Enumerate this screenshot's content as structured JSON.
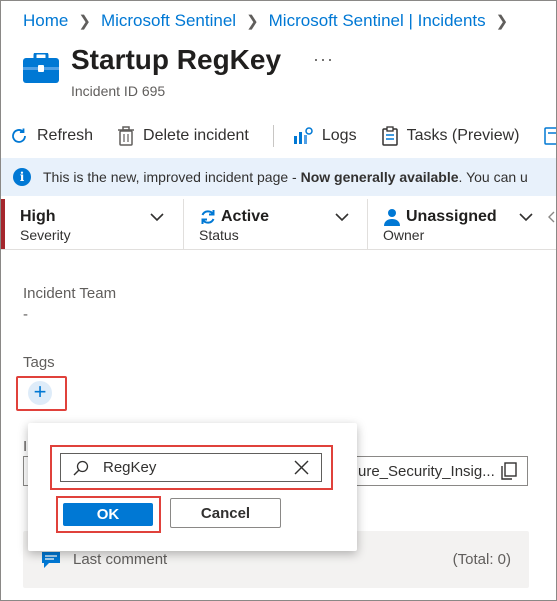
{
  "breadcrumb": [
    {
      "label": "Home"
    },
    {
      "label": "Microsoft Sentinel"
    },
    {
      "label": "Microsoft Sentinel | Incidents"
    }
  ],
  "header": {
    "title": "Startup RegKey",
    "more_label": "···",
    "subtitle": "Incident ID 695"
  },
  "toolbar": {
    "refresh": "Refresh",
    "delete": "Delete incident",
    "logs": "Logs",
    "tasks": "Tasks (Preview)"
  },
  "banner": {
    "text_before": "This is the new, improved incident page - ",
    "text_bold": "Now generally available",
    "text_after": ". You can u"
  },
  "status_bar": {
    "severity": {
      "value": "High",
      "label": "Severity"
    },
    "status": {
      "value": "Active",
      "label": "Status"
    },
    "owner": {
      "value": "Unassigned",
      "label": "Owner"
    }
  },
  "fields": {
    "team_label": "Incident Team",
    "team_value": "-",
    "tags_label": "Tags",
    "add_tag_symbol": "+",
    "behind_label": "I",
    "link_value": "ure_Security_Insig..."
  },
  "comment": {
    "label": "Last comment",
    "total": "(Total: 0)"
  },
  "tag_popup": {
    "search_value": "RegKey",
    "ok_label": "OK",
    "cancel_label": "Cancel"
  },
  "colors": {
    "accent": "#0078d4",
    "severity_high": "#a4262c",
    "highlight": "#e0413b",
    "banner_bg": "#e8f1fb"
  },
  "icons": {
    "app": "briefcase-icon",
    "refresh": "refresh-icon",
    "delete": "trash-icon",
    "logs": "logs-chart-icon",
    "tasks": "clipboard-icon",
    "info": "info-icon",
    "owner": "person-icon",
    "comment": "comment-icon",
    "search": "search-icon",
    "clear": "close-icon",
    "copy": "copy-icon"
  }
}
